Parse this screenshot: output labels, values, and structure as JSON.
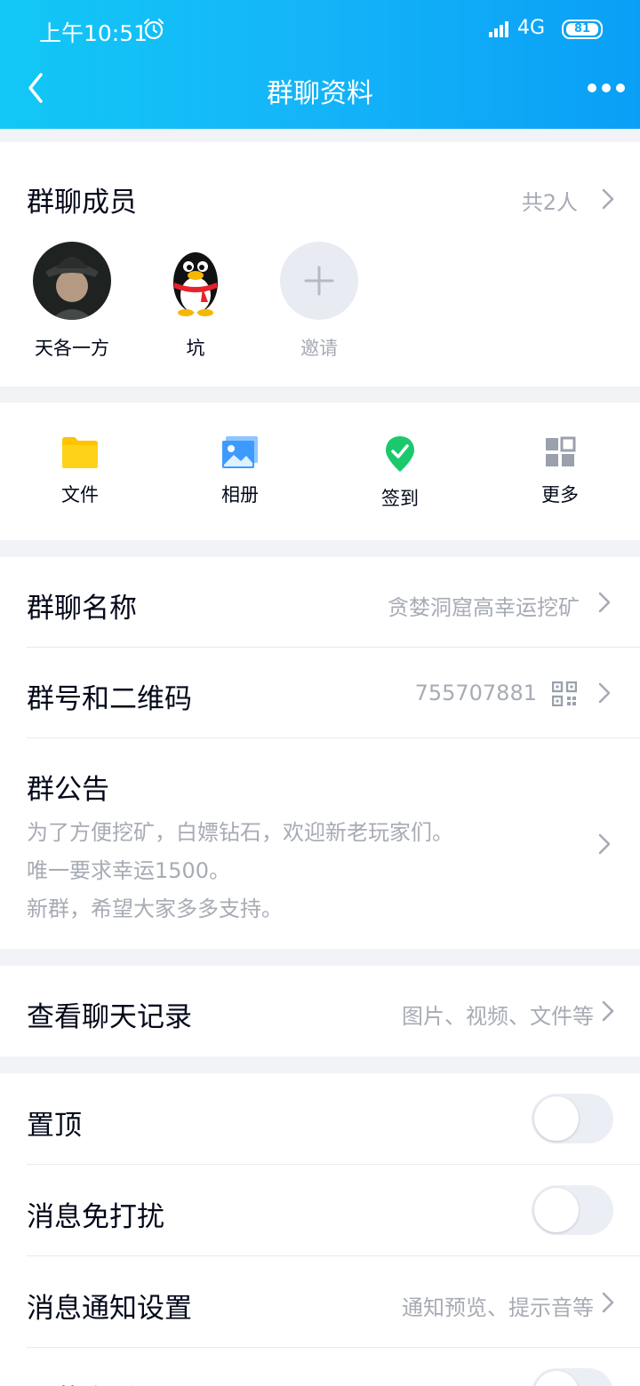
{
  "status_bar": {
    "time": "上午10:51",
    "network": "4G",
    "battery": "81"
  },
  "header": {
    "title": "群聊资料"
  },
  "members": {
    "title": "群聊成员",
    "count": "共2人",
    "list": [
      {
        "name": "天各一方"
      },
      {
        "name": "坑"
      }
    ],
    "invite_label": "邀请"
  },
  "tools": [
    {
      "label": "文件",
      "icon": "folder-icon"
    },
    {
      "label": "相册",
      "icon": "album-icon"
    },
    {
      "label": "签到",
      "icon": "check-in-icon"
    },
    {
      "label": "更多",
      "icon": "grid-icon"
    }
  ],
  "group_name": {
    "label": "群聊名称",
    "value": "贪婪洞窟高幸运挖矿"
  },
  "group_id": {
    "label": "群号和二维码",
    "value": "755707881"
  },
  "notice": {
    "label": "群公告",
    "lines": [
      "为了方便挖矿，白嫖钻石，欢迎新老玩家们。",
      "唯一要求幸运1500。",
      "新群，希望大家多多支持。"
    ]
  },
  "history": {
    "label": "查看聊天记录",
    "value": "图片、视频、文件等"
  },
  "pin": {
    "label": "置顶",
    "on": false
  },
  "mute": {
    "label": "消息免打扰",
    "on": false
  },
  "notify": {
    "label": "消息通知设置",
    "value": "通知预览、提示音等"
  },
  "hide": {
    "label": "隐藏会话"
  },
  "colors": {
    "header_start": "#12c8f6",
    "header_end": "#0a9ff6",
    "text_secondary": "#a7abb4",
    "check_green": "#1bc96c"
  }
}
